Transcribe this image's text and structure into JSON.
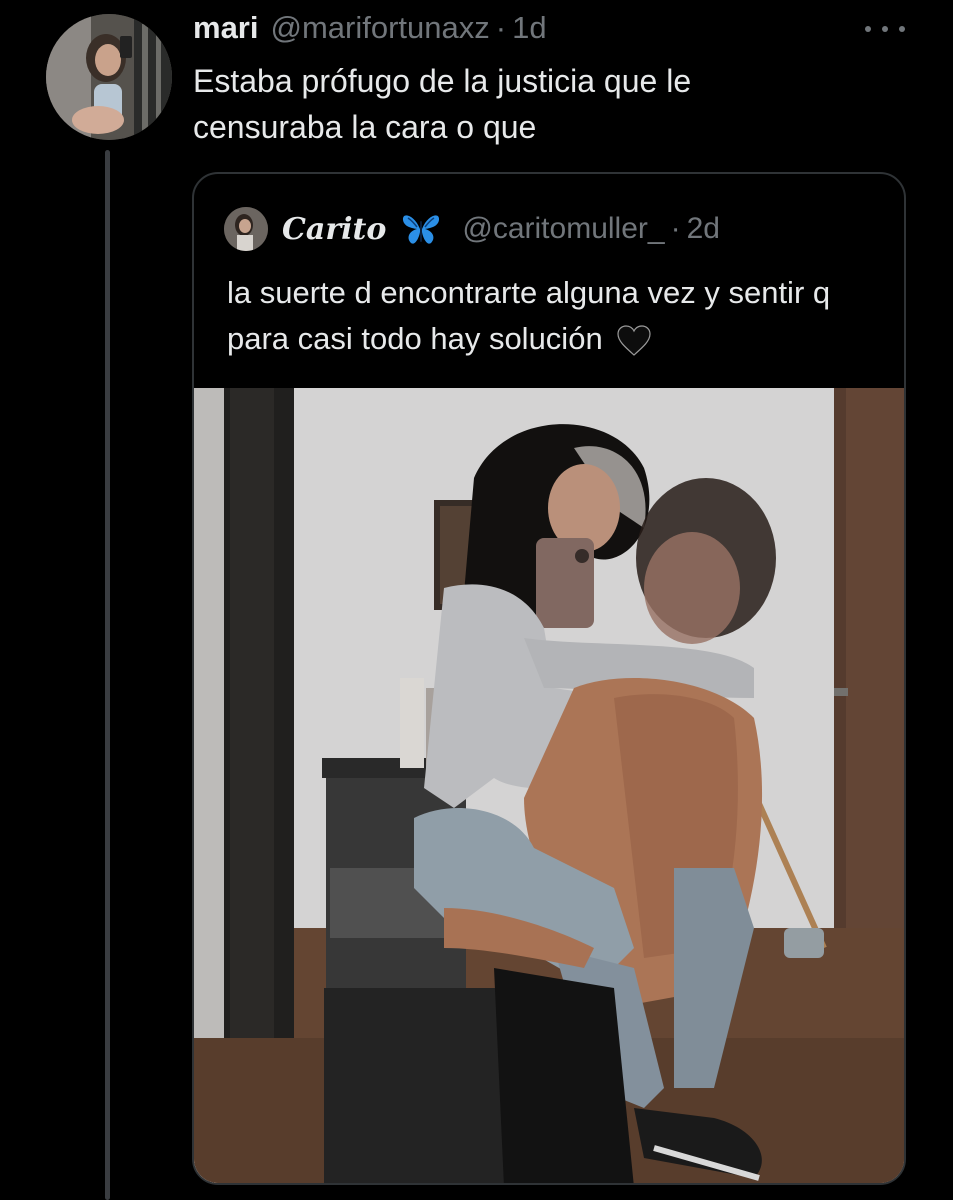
{
  "tweet": {
    "author_name": "mari",
    "author_handle": "@marifortunaxz",
    "separator": "·",
    "time": "1d",
    "text": "Estaba prófugo de la justicia que le censuraba la cara o que",
    "avatar_icon": "profile-photo-icon",
    "more_icon": "more-options-icon"
  },
  "quote": {
    "author_name": "Carito",
    "author_handle": "@caritomuller_",
    "separator": "·",
    "time": "2d",
    "text": "la suerte d encontrarte alguna vez y sentir q para casi todo hay solución",
    "emoji_after_name": "blue-butterfly-icon",
    "emoji_after_text": "black-heart-icon",
    "media": "photo"
  },
  "colors": {
    "background": "#000000",
    "text_primary": "#e7e9ea",
    "text_secondary": "#71767b",
    "border": "#2f3336",
    "butterfly": "#1d9bf0"
  }
}
